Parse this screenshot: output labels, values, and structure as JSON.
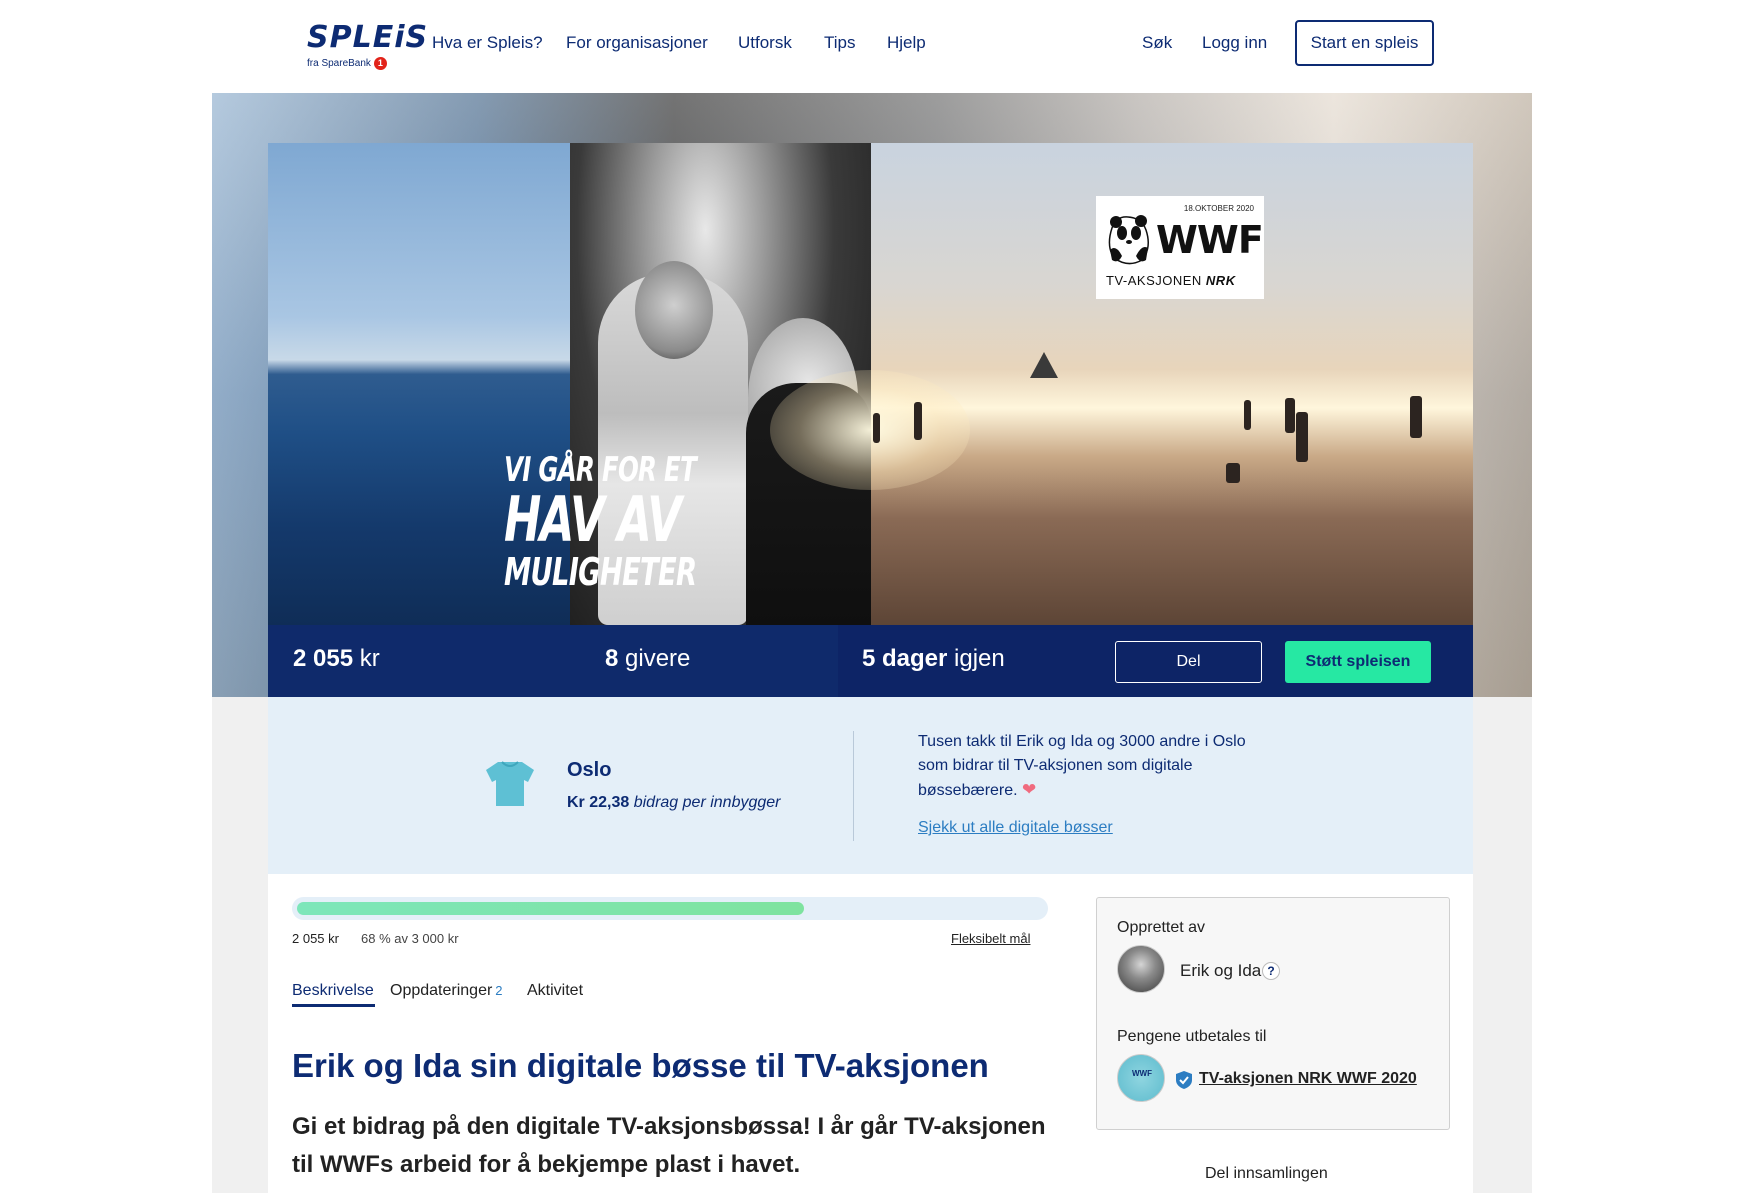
{
  "nav": {
    "logo_text": "SPLEiS",
    "logo_sub": "fra SpareBank",
    "logo_sub_badge": "1",
    "links": [
      "Hva er Spleis?",
      "For organisasjoner",
      "Utforsk",
      "Tips",
      "Hjelp"
    ],
    "search": "Søk",
    "login": "Logg inn",
    "start_button": "Start en spleis"
  },
  "hero": {
    "text_line1": "VI GÅR FOR ET",
    "text_line2": "HAV AV",
    "text_line3": "MULIGHETER",
    "badge_date": "18.OKTOBER 2020",
    "badge_logo": "WWF",
    "badge_sub": "TV-AKSJONEN",
    "badge_sub_brand": "NRK"
  },
  "stats": {
    "amount_value": "2 055",
    "amount_unit": "kr",
    "donors_value": "8",
    "donors_unit": "givere",
    "days_value": "5 dager",
    "days_unit": "igjen",
    "share_button": "Del",
    "support_button": "Støtt spleisen"
  },
  "tv_aksjon": {
    "city": "Oslo",
    "per_capita_amount": "Kr 22,38",
    "per_capita_label": "bidrag per innbygger",
    "thanks_text": "Tusen takk til Erik og Ida og 3000 andre i Oslo som bidrar til TV-aksjonen som digitale bøssebærere.",
    "heart": "❤",
    "link": "Sjekk ut alle digitale bøsser"
  },
  "progress": {
    "fraction": 0.68,
    "amount": "2 055 kr",
    "percent_text": "68 % av 3 000 kr",
    "flex_goal": "Fleksibelt mål",
    "fill_color": "#7de6ba"
  },
  "tabs": [
    {
      "label": "Beskrivelse",
      "active": true
    },
    {
      "label": "Oppdateringer",
      "count": "2"
    },
    {
      "label": "Aktivitet"
    }
  ],
  "content": {
    "title": "Erik og Ida sin digitale bøsse til TV-aksjonen",
    "lead": "Gi et bidrag på den digitale TV-aksjonsbøssa! I år går TV-aksjonen til WWFs arbeid for å bekjempe plast i havet."
  },
  "sidebar": {
    "created_by_label": "Opprettet av",
    "creator_name": "Erik og Ida",
    "help_icon": "?",
    "payout_label": "Pengene utbetales til",
    "org_avatar_text": "WWF",
    "org_name": "TV-aksjonen NRK WWF 2020",
    "share_label": "Del innsamlingen"
  },
  "colors": {
    "brand_navy": "#0d2b73",
    "accent_green": "#26e8a3",
    "panel_blue": "#e4eff8",
    "link_blue": "#2c7dc2"
  }
}
